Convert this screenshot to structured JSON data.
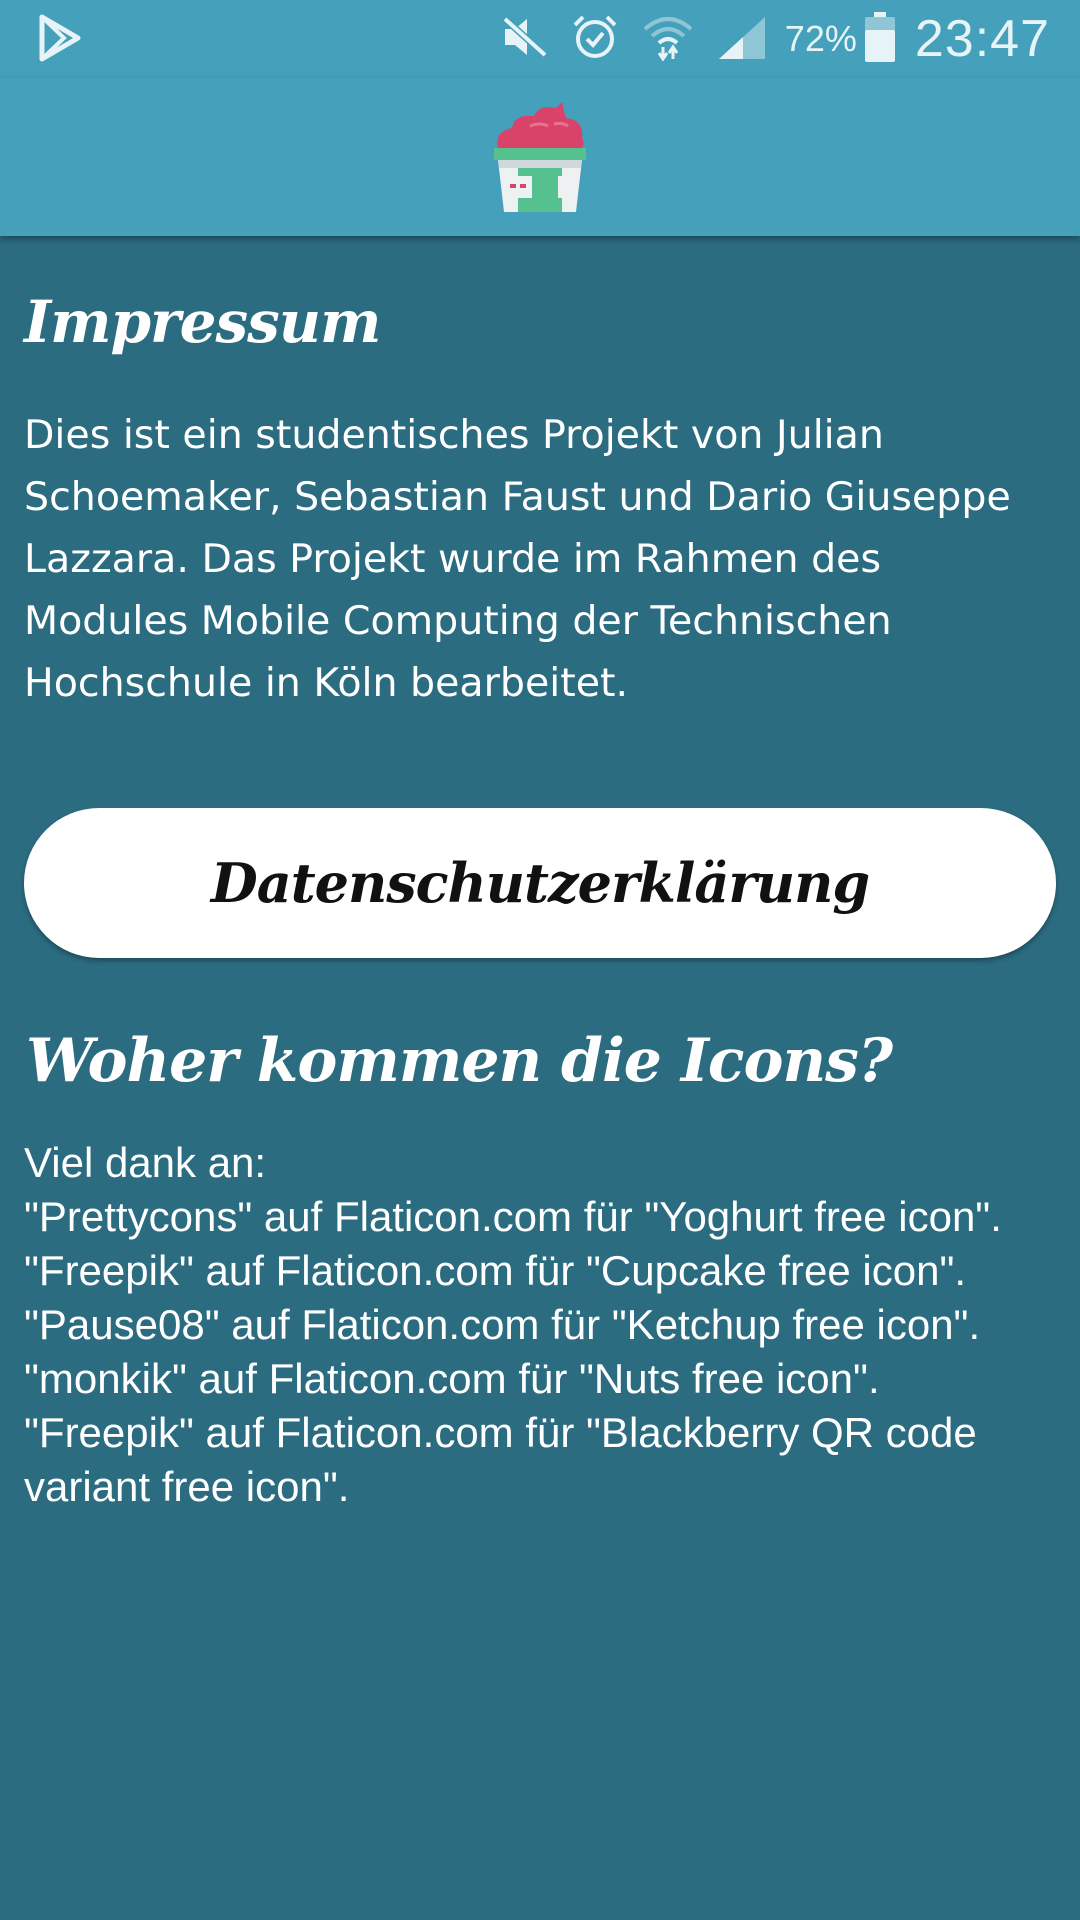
{
  "status_bar": {
    "battery_percent": "72%",
    "time": "23:47",
    "icons": [
      "play-store-icon",
      "mute-icon",
      "alarm-icon",
      "wifi-icon",
      "signal-icon",
      "battery-icon"
    ]
  },
  "app_bar": {
    "logo_icon": "cupcake-icon"
  },
  "impressum": {
    "title": "Impressum",
    "text": "Dies ist ein studentisches Projekt von Julian Schoemaker, Sebastian Faust und Dario Giuseppe Lazzara. Das Projekt wurde im Rahmen des Modules Mobile Computing der Technischen Hochschule in Köln bearbeitet."
  },
  "privacy_button": {
    "label": "Datenschutzerklärung"
  },
  "icons_section": {
    "title": "Woher kommen die Icons?",
    "lines": [
      "Viel dank an:",
      "\"Prettycons\" auf Flaticon.com für \"Yoghurt free icon\".",
      "\"Freepik\" auf Flaticon.com für \"Cupcake free icon\".",
      "\"Pause08\" auf Flaticon.com für \"Ketchup free icon\".",
      "\"monkik\" auf Flaticon.com für \"Nuts free icon\".",
      "\"Freepik\" auf Flaticon.com für \"Blackberry QR code variant free icon\"."
    ]
  },
  "colors": {
    "header": "#44a0bb",
    "background": "#2b6c80",
    "button": "#ffffff"
  }
}
